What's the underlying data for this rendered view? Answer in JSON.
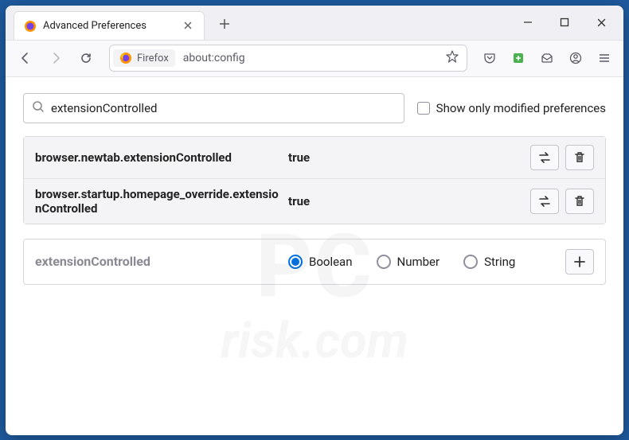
{
  "tab": {
    "title": "Advanced Preferences"
  },
  "urlbar": {
    "identity": "Firefox",
    "url": "about:config"
  },
  "search": {
    "value": "extensionControlled",
    "checkbox_label": "Show only modified preferences"
  },
  "prefs": [
    {
      "name": "browser.newtab.extensionControlled",
      "value": "true"
    },
    {
      "name": "browser.startup.homepage_override.extensionControlled",
      "value": "true"
    }
  ],
  "add": {
    "name": "extensionControlled",
    "types": [
      "Boolean",
      "Number",
      "String"
    ],
    "selected": "Boolean"
  }
}
